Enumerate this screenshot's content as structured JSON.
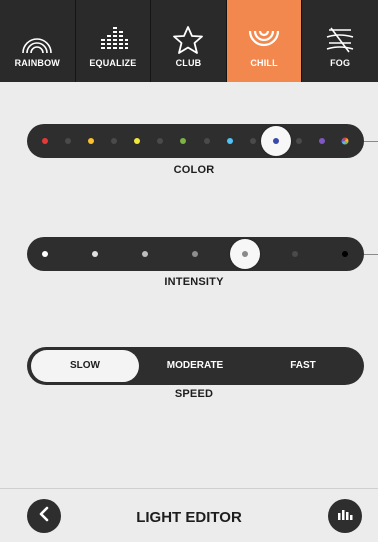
{
  "tabs": [
    {
      "label": "RAINBOW",
      "icon": "rainbow-icon",
      "active": false
    },
    {
      "label": "EQUALIZE",
      "icon": "equalizer-icon",
      "active": false
    },
    {
      "label": "CLUB",
      "icon": "star-icon",
      "active": false
    },
    {
      "label": "CHILL",
      "icon": "chill-waves-icon",
      "active": true
    },
    {
      "label": "FOG",
      "icon": "fog-icon",
      "active": false
    }
  ],
  "colors": {
    "accent": "#f3884e",
    "track": "#2e2e2e",
    "tab_bar": "#2a2a2a",
    "background": "#ececec"
  },
  "color_slider": {
    "label": "COLOR",
    "dots": [
      "#e53935",
      "#4a4a4a",
      "#fbc02d",
      "#4a4a4a",
      "#f2e83a",
      "#4a4a4a",
      "#7cb342",
      "#4a4a4a",
      "#4fc3f7",
      "#4a4a4a",
      "#3949ab",
      "#4a4a4a",
      "#7e57c2",
      "multicolor"
    ],
    "selected_index": 10,
    "selected_color": "#3949ab"
  },
  "intensity_slider": {
    "label": "INTENSITY",
    "dots": [
      "#ffffff",
      "#e0e0e0",
      "#bdbdbd",
      "#8e8e8e",
      "#6a6a6a",
      "#4a4a4a",
      "#000000"
    ],
    "selected_index": 4
  },
  "speed": {
    "label": "SPEED",
    "options": [
      "SLOW",
      "MODERATE",
      "FAST"
    ],
    "selected": "SLOW"
  },
  "footer": {
    "title": "LIGHT EDITOR",
    "back_icon": "chevron-left-icon",
    "right_icon": "bar-chart-icon"
  }
}
